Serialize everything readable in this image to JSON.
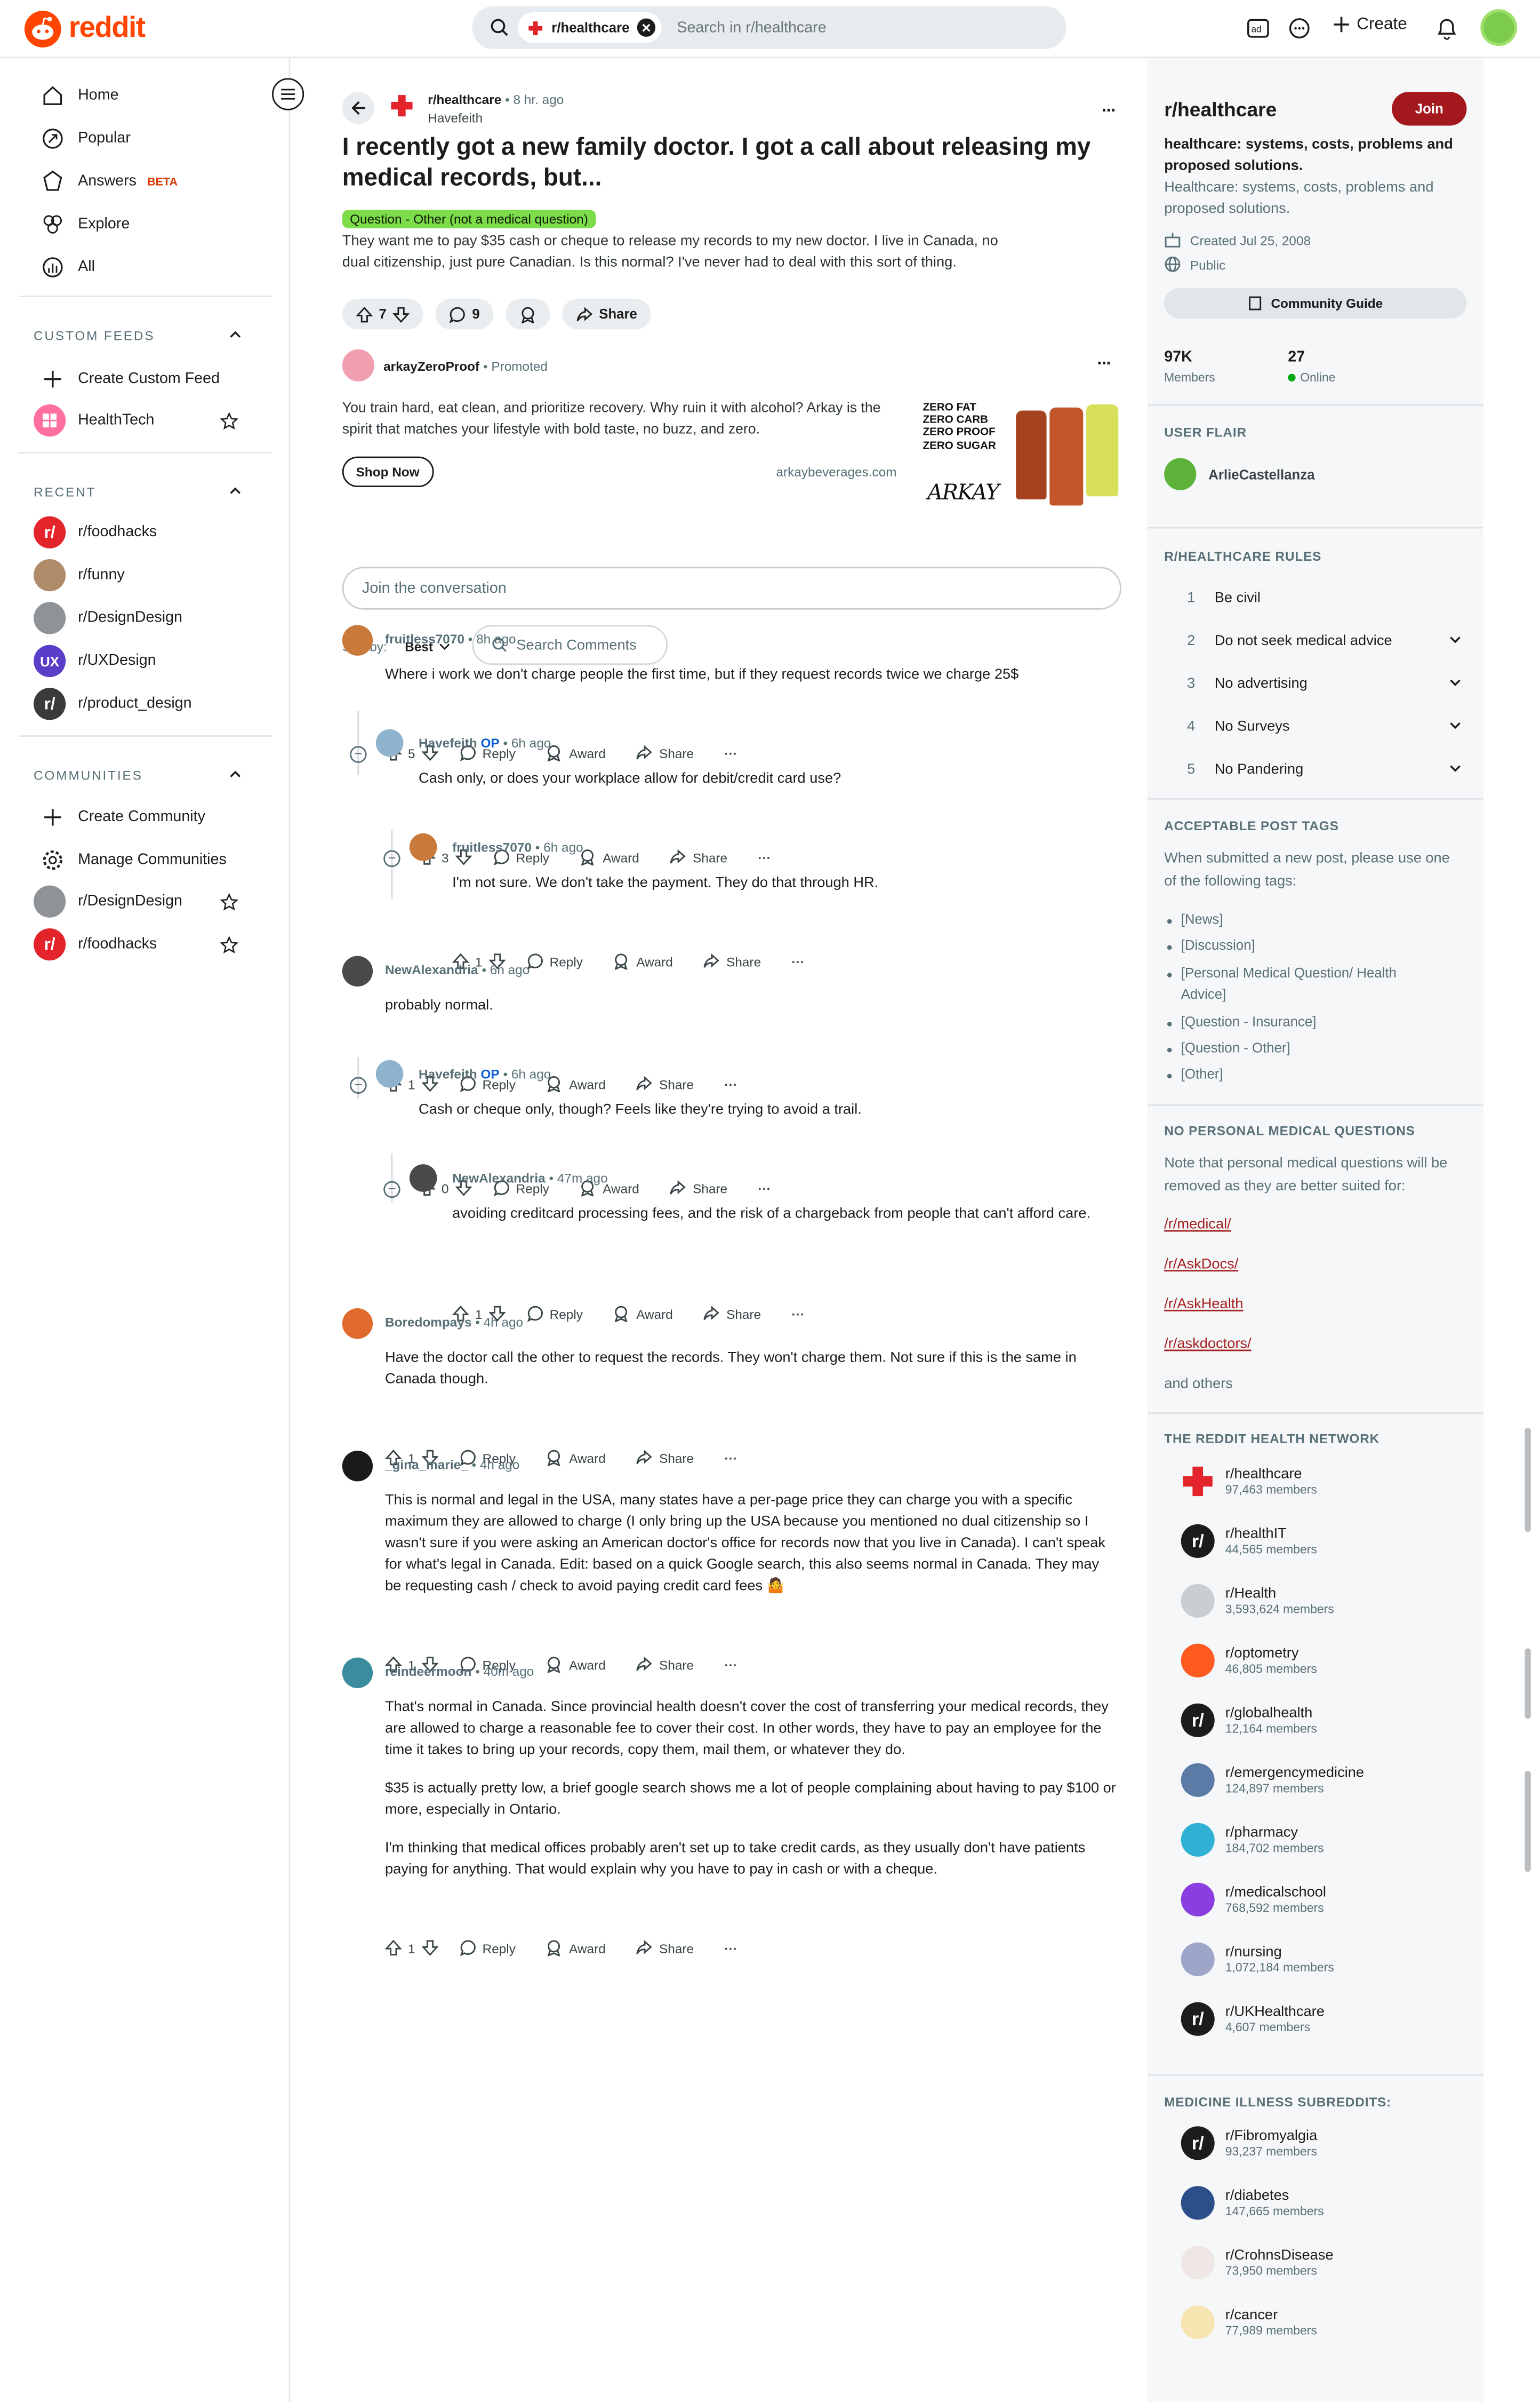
{
  "header": {
    "logo_text": "reddit",
    "search_chip": "r/healthcare",
    "search_placeholder": "Search in r/healthcare",
    "create_label": "Create"
  },
  "sidebar": {
    "nav": [
      {
        "label": "Home",
        "icon": "home-icon"
      },
      {
        "label": "Popular",
        "icon": "popular-icon"
      },
      {
        "label": "Answers",
        "badge": "BETA",
        "icon": "answers-icon"
      },
      {
        "label": "Explore",
        "icon": "explore-icon"
      },
      {
        "label": "All",
        "icon": "all-icon"
      }
    ],
    "custom_feeds_title": "CUSTOM FEEDS",
    "create_custom_feed": "Create Custom Feed",
    "healthtech": "HealthTech",
    "recent_title": "RECENT",
    "recent": [
      "r/foodhacks",
      "r/funny",
      "r/DesignDesign",
      "r/UXDesign",
      "r/product_design"
    ],
    "communities_title": "COMMUNITIES",
    "create_community": "Create Community",
    "manage_communities": "Manage Communities",
    "communities": [
      "r/DesignDesign",
      "r/foodhacks"
    ]
  },
  "post": {
    "subreddit": "r/healthcare",
    "time": "8 hr. ago",
    "author": "Havefeith",
    "title": "I recently got a new family doctor. I got a call about releasing my medical records, but...",
    "flair": "Question - Other (not a medical question)",
    "body": "They want me to pay $35 cash or cheque to release my records to my new doctor. I live in Canada, no dual citizenship, just pure Canadian. Is this normal? I've never had to deal with this sort of thing.",
    "votes": "7",
    "comments": "9",
    "share": "Share"
  },
  "ad": {
    "advertiser": "arkayZeroProof",
    "promoted": "Promoted",
    "body": "You train hard, eat clean, and prioritize recovery. Why ruin it with alcohol? Arkay is the spirit that matches your lifestyle with bold taste, no buzz, and zero.",
    "cta": "Shop Now",
    "domain": "arkaybeverages.com",
    "img_lines": [
      "ZERO FAT",
      "ZERO CARB",
      "ZERO PROOF",
      "ZERO SUGAR"
    ],
    "brand": "ARKAY"
  },
  "conversation": {
    "join_placeholder": "Join the conversation",
    "sort_by": "Sort by:",
    "sort_value": "Best",
    "search_comments": "Search Comments"
  },
  "labels": {
    "reply": "Reply",
    "award": "Award",
    "share": "Share",
    "op": "OP",
    "dot": "•",
    "more": "···"
  },
  "comments": [
    {
      "user": "fruitless7070",
      "time": "8h ago",
      "text": "Where i work we don't charge people the first time, but if they request records twice we charge 25$",
      "votes": "5"
    },
    {
      "user": "Havefeith",
      "time": "6h ago",
      "text": "Cash only, or does your workplace allow for debit/credit card use?",
      "votes": "3"
    },
    {
      "user": "fruitless7070",
      "time": "6h ago",
      "text": "I'm not sure. We don't take the payment. They do that through HR.",
      "votes": "1"
    },
    {
      "user": "NewAlexandria",
      "time": "6h ago",
      "text": "probably normal.",
      "votes": "1"
    },
    {
      "user": "Havefeith",
      "time": "6h ago",
      "text": "Cash or cheque only, though? Feels like they're trying to avoid a trail.",
      "votes": "0"
    },
    {
      "user": "NewAlexandria",
      "time": "47m ago",
      "text": "avoiding creditcard processing fees, and the risk of a chargeback from people that can't afford care.",
      "votes": "1"
    },
    {
      "user": "Boredompays",
      "time": "4h ago",
      "text": "Have the doctor call the other to request the records. They won't charge them. Not sure if this is the same in Canada though.",
      "votes": "1"
    },
    {
      "user": "_gina_marie_",
      "time": "4h ago",
      "text": "This is normal and legal in the USA, many states have a per-page price they can charge you with a specific maximum they are allowed to charge (I only bring up the USA because you mentioned no dual citizenship so I wasn't sure if you were asking an American doctor's office for records now that you live in Canada). I can't speak for what's legal in Canada. Edit: based on a quick Google search, this also seems normal in Canada. They may be requesting cash / check to avoid paying credit card fees 🤷",
      "votes": "1"
    },
    {
      "user": "reindeermoon",
      "time": "40m ago",
      "text": "That's normal in Canada. Since provincial health doesn't cover the cost of transferring your medical records, they are allowed to charge a reasonable fee to cover their cost. In other words, they have to pay an employee for the time it takes to bring up your records, copy them, mail them, or whatever they do.",
      "text2": "$35 is actually pretty low, a brief google search shows me a lot of people complaining about having to pay $100 or more, especially in Ontario.",
      "text3": "I'm thinking that medical offices probably aren't set up to take credit cards, as they usually don't have patients paying for anything. That would explain why you have to pay in cash or with a cheque.",
      "votes": "1"
    }
  ],
  "right": {
    "name": "r/healthcare",
    "join": "Join",
    "tagline": "healthcare: systems, costs, problems and proposed solutions.",
    "description": "Healthcare: systems, costs, problems and proposed solutions.",
    "created": "Created Jul 25, 2008",
    "public": "Public",
    "guide": "Community Guide",
    "members_count": "97K",
    "members_label": "Members",
    "online_count": "27",
    "online_label": "Online",
    "user_flair_title": "USER FLAIR",
    "flair_user": "ArlieCastellanza",
    "rules_title": "R/HEALTHCARE RULES",
    "rules": [
      "Be civil",
      "Do not seek medical advice",
      "No advertising",
      "No Surveys",
      "No Pandering"
    ],
    "tags_title": "ACCEPTABLE POST TAGS",
    "tags_intro": "When submitted a new post, please use one of the following tags:",
    "tags": [
      "[News]",
      "[Discussion]",
      "[Personal Medical Question/ Health",
      "Advice]",
      "[Question - Insurance]",
      "[Question - Other]",
      "[Other]"
    ],
    "npmq_title": "NO PERSONAL MEDICAL QUESTIONS",
    "npmq_text": "Note that personal medical questions will be removed as they are better suited for:",
    "npmq_links": [
      "/r/medical/",
      "/r/AskDocs/",
      "/r/AskHealth",
      "/r/askdoctors/"
    ],
    "npmq_others": "and others",
    "network_title": "THE REDDIT HEALTH NETWORK",
    "network": [
      {
        "name": "r/healthcare",
        "members": "97,463 members"
      },
      {
        "name": "r/healthIT",
        "members": "44,565 members"
      },
      {
        "name": "r/Health",
        "members": "3,593,624 members"
      },
      {
        "name": "r/optometry",
        "members": "46,805 members"
      },
      {
        "name": "r/globalhealth",
        "members": "12,164 members"
      },
      {
        "name": "r/emergencymedicine",
        "members": "124,897 members"
      },
      {
        "name": "r/pharmacy",
        "members": "184,702 members"
      },
      {
        "name": "r/medicalschool",
        "members": "768,592 members"
      },
      {
        "name": "r/nursing",
        "members": "1,072,184 members"
      },
      {
        "name": "r/UKHealthcare",
        "members": "4,607 members"
      }
    ],
    "illness_title": "MEDICINE ILLNESS SUBREDDITS:",
    "illness": [
      {
        "name": "r/Fibromyalgia",
        "members": "93,237 members"
      },
      {
        "name": "r/diabetes",
        "members": "147,665 members"
      },
      {
        "name": "r/CrohnsDisease",
        "members": "73,950 members"
      },
      {
        "name": "r/cancer",
        "members": "77,989 members"
      }
    ]
  }
}
